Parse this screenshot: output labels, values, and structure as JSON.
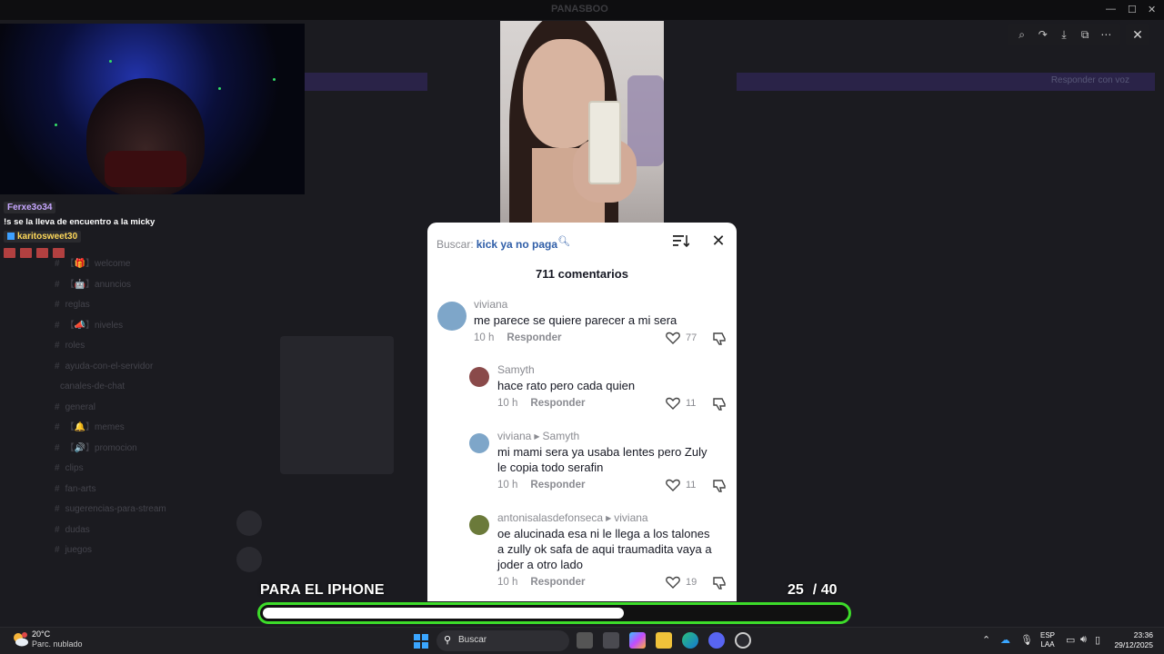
{
  "background_app": {
    "title": "PANASBOO",
    "channels": [
      {
        "icon": "#",
        "label": "【🎁】welcome"
      },
      {
        "icon": "#",
        "label": "【🤖】anuncios"
      },
      {
        "icon": "#",
        "label": "reglas"
      },
      {
        "icon": "#",
        "label": "【📣】niveles"
      },
      {
        "icon": "#",
        "label": "roles"
      },
      {
        "icon": "#",
        "label": "ayuda-con-el-servidor"
      },
      {
        "icon": "",
        "label": "canales-de-chat"
      },
      {
        "icon": "#",
        "label": "general"
      },
      {
        "icon": "#",
        "label": "【🔔】memes"
      },
      {
        "icon": "#",
        "label": "【🔊】promocion"
      },
      {
        "icon": "#",
        "label": "clips"
      },
      {
        "icon": "#",
        "label": "fan-arts"
      },
      {
        "icon": "#",
        "label": "sugerencias-para-stream"
      },
      {
        "icon": "#",
        "label": "dudas"
      },
      {
        "icon": "#",
        "label": "juegos"
      }
    ],
    "banner_right": "Responder con voz"
  },
  "stream_chat": {
    "msg1_user": "Ferxe3o34",
    "msg1_text": "!s se la lleva de encuentro a la micky",
    "msg2_user": "karitosweet30"
  },
  "viewer": {
    "tools": [
      {
        "name": "zoom-icon",
        "glyph": "⌕"
      },
      {
        "name": "share-icon",
        "glyph": "↷"
      },
      {
        "name": "download-icon",
        "glyph": "⤓"
      },
      {
        "name": "open-external-icon",
        "glyph": "⧉"
      },
      {
        "name": "more-icon",
        "glyph": "⋯"
      }
    ],
    "close_glyph": "✕"
  },
  "comments_panel": {
    "search_label": "Buscar:",
    "search_term": "kick ya no paga",
    "count_label": "711 comentarios",
    "reply_label": "Responder",
    "comments": [
      {
        "user": "viviana",
        "reply_to": "",
        "text_lines": [
          "me parece se quiere parecer a mi sera"
        ],
        "time": "10 h",
        "likes": "77",
        "avatar_color": "#7ea6c9"
      },
      {
        "user": "Samyth",
        "reply_to": "",
        "text_lines": [
          "hace rato pero cada quien"
        ],
        "time": "10 h",
        "likes": "11",
        "avatar_color": "#8a4a4a"
      },
      {
        "user": "viviana",
        "reply_to": "Samyth",
        "text_lines": [
          "mi mami sera ya usaba lentes pero Zuly",
          "le copia todo serafin"
        ],
        "time": "10 h",
        "likes": "11",
        "avatar_color": "#7ea6c9"
      },
      {
        "user": "antonisalasdefonseca",
        "reply_to": "viviana",
        "text_lines": [
          "oe alucinada esa ni le llega a los talones",
          "a zully ok safa de aqui traumadita vaya a",
          "joder a otro lado"
        ],
        "time": "10 h",
        "likes": "19",
        "avatar_color": "#6b7a3a"
      }
    ]
  },
  "overlay": {
    "caption": "PARA EL IPHONE",
    "counter_current": "25",
    "counter_total": "/ 40",
    "progress_fraction": 0.62,
    "progress_color": "#3ddc2a"
  },
  "taskbar": {
    "temperature": "20°C",
    "weather": "Parc. nublado",
    "search_label": "Buscar",
    "lang_line1": "ESP",
    "lang_line2": "LAA",
    "time": "23:36",
    "date": "29/12/2025"
  }
}
